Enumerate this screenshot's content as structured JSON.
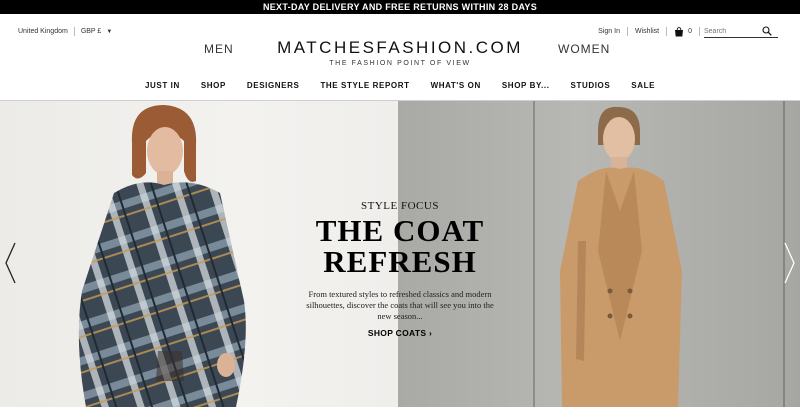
{
  "promo": {
    "text": "NEXT-DAY DELIVERY AND FREE RETURNS WITHIN 28 DAYS"
  },
  "locale": {
    "country": "United Kingdom",
    "currency": "GBP £"
  },
  "account": {
    "sign_in": "Sign In",
    "wishlist": "Wishlist",
    "bag_count": "0",
    "search_placeholder": "Search"
  },
  "header": {
    "men": "MEN",
    "women": "WOMEN",
    "logo": "MATCHESFASHION.COM",
    "tagline": "THE FASHION POINT OF VIEW"
  },
  "nav": {
    "items": [
      "JUST IN",
      "SHOP",
      "DESIGNERS",
      "THE STYLE REPORT",
      "WHAT'S ON",
      "SHOP BY...",
      "STUDIOS",
      "SALE"
    ]
  },
  "hero": {
    "kicker": "STYLE FOCUS",
    "headline_line1": "THE COAT",
    "headline_line2": "REFRESH",
    "body": "From textured styles to refreshed classics and modern silhouettes, discover the coats that will see you into the new season...",
    "cta": "SHOP COATS ›"
  },
  "colors": {
    "promo_bg": "#000000",
    "right_panel": "#b1b2ae",
    "left_panel": "#f0efec",
    "plaid_coat": "#3b4552",
    "camel_coat": "#c79a6b"
  },
  "icons": {
    "bag": "shopping-bag-icon",
    "search": "search-icon",
    "prev": "chevron-left-icon",
    "next": "chevron-right-icon"
  }
}
